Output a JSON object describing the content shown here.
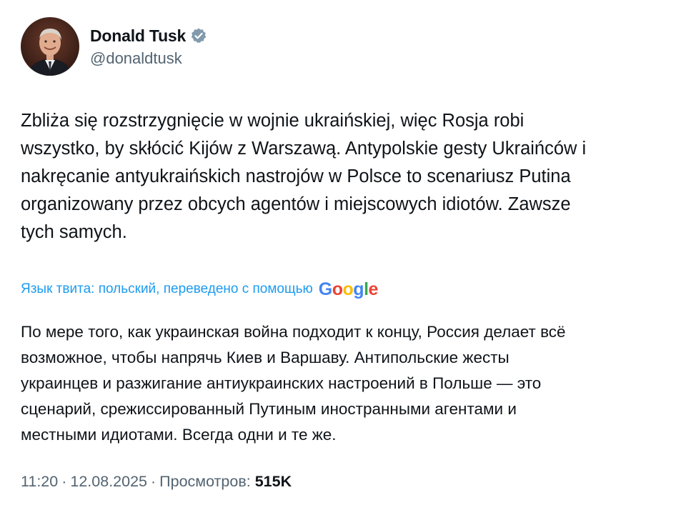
{
  "author": {
    "display_name": "Donald Tusk",
    "handle": "@donaldtusk",
    "verified": true,
    "verified_color": "#829aab"
  },
  "tweet": {
    "text": "Zbliża się rozstrzygnięcie w wojnie ukraińskiej, więc Rosja robi\nwszystko, by skłócić Kijów z Warszawą. Antypolskie gesty Ukraińców i\nnakręcanie antyukraińskich nastrojów w Polsce to scenariusz Putina\norganizowany przez obcych agentów i miejscowych idiotów. Zawsze\ntych samych."
  },
  "translation": {
    "label": "Язык твита: польский, переведено с помощью",
    "provider_logo": "Google",
    "provider_logo_letters": [
      {
        "char": "G",
        "color": "#4285f4"
      },
      {
        "char": "o",
        "color": "#ea4335"
      },
      {
        "char": "o",
        "color": "#fbbc05"
      },
      {
        "char": "g",
        "color": "#4285f4"
      },
      {
        "char": "l",
        "color": "#34a853"
      },
      {
        "char": "e",
        "color": "#ea4335"
      }
    ],
    "text": "По мере того, как украинская война подходит к концу, Россия делает всё\nвозможное, чтобы напрячь Киев и Варшаву. Антипольские жесты\nукраинцев и разжигание антиукраинских настроений в Польше — это\nсценарий, срежиссированный Путиным иностранными агентами и\nместными идиотами. Всегда одни и те же."
  },
  "meta": {
    "time": "11:20",
    "separator": "·",
    "date": "12.08.2025",
    "views_label": "Просмотров:",
    "views_count": "515K"
  },
  "colors": {
    "text_primary": "#0f1419",
    "text_secondary": "#536471",
    "link_blue": "#1d9bf0"
  }
}
